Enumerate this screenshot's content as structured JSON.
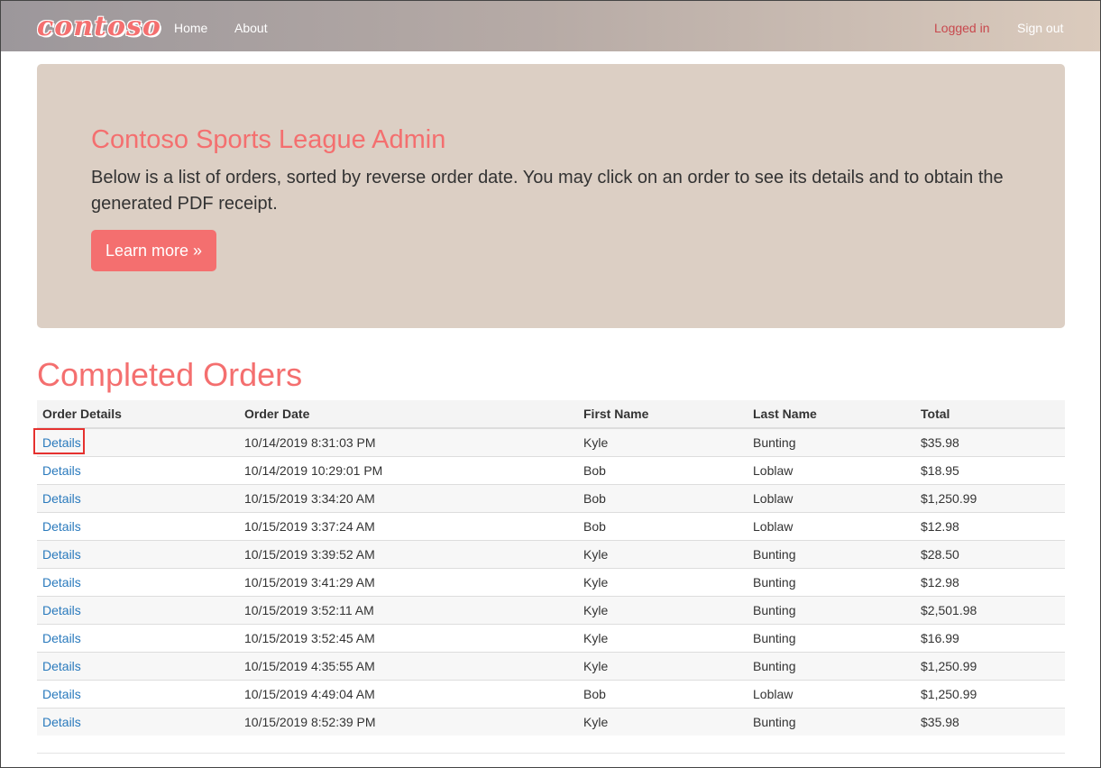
{
  "navbar": {
    "brand": "contoso",
    "links": [
      "Home",
      "About"
    ],
    "logged_in": "Logged in",
    "sign_out": "Sign out"
  },
  "jumbotron": {
    "title": "Contoso Sports League Admin",
    "text": "Below is a list of orders, sorted by reverse order date. You may click on an order to see its details and to obtain the generated PDF receipt.",
    "button": "Learn more »"
  },
  "orders": {
    "title": "Completed Orders",
    "columns": [
      "Order Details",
      "Order Date",
      "First Name",
      "Last Name",
      "Total"
    ],
    "rows": [
      {
        "details": "Details",
        "date": "10/14/2019 8:31:03 PM",
        "first": "Kyle",
        "last": "Bunting",
        "total": "$35.98"
      },
      {
        "details": "Details",
        "date": "10/14/2019 10:29:01 PM",
        "first": "Bob",
        "last": "Loblaw",
        "total": "$18.95"
      },
      {
        "details": "Details",
        "date": "10/15/2019 3:34:20 AM",
        "first": "Bob",
        "last": "Loblaw",
        "total": "$1,250.99"
      },
      {
        "details": "Details",
        "date": "10/15/2019 3:37:24 AM",
        "first": "Bob",
        "last": "Loblaw",
        "total": "$12.98"
      },
      {
        "details": "Details",
        "date": "10/15/2019 3:39:52 AM",
        "first": "Kyle",
        "last": "Bunting",
        "total": "$28.50"
      },
      {
        "details": "Details",
        "date": "10/15/2019 3:41:29 AM",
        "first": "Kyle",
        "last": "Bunting",
        "total": "$12.98"
      },
      {
        "details": "Details",
        "date": "10/15/2019 3:52:11 AM",
        "first": "Kyle",
        "last": "Bunting",
        "total": "$2,501.98"
      },
      {
        "details": "Details",
        "date": "10/15/2019 3:52:45 AM",
        "first": "Kyle",
        "last": "Bunting",
        "total": "$16.99"
      },
      {
        "details": "Details",
        "date": "10/15/2019 4:35:55 AM",
        "first": "Kyle",
        "last": "Bunting",
        "total": "$1,250.99"
      },
      {
        "details": "Details",
        "date": "10/15/2019 4:49:04 AM",
        "first": "Bob",
        "last": "Loblaw",
        "total": "$1,250.99"
      },
      {
        "details": "Details",
        "date": "10/15/2019 8:52:39 PM",
        "first": "Kyle",
        "last": "Bunting",
        "total": "$35.98"
      }
    ]
  },
  "colors": {
    "accent": "#f46f6f",
    "link": "#2a7abd",
    "jumbotron_bg": "#dccfc4",
    "highlight": "#e5312f"
  }
}
